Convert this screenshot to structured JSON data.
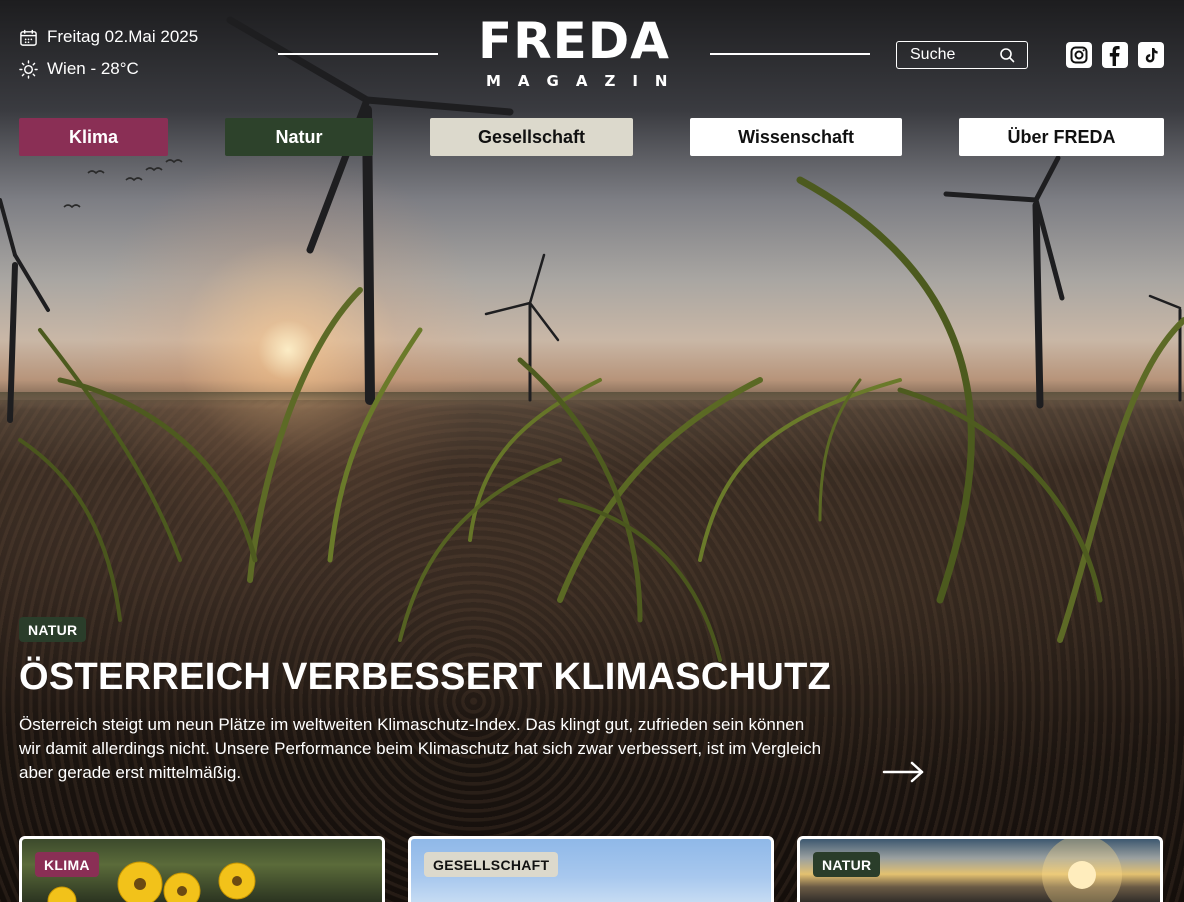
{
  "header": {
    "date": "Freitag 02.Mai 2025",
    "weather": "Wien - 28°C",
    "logo_main": "FREDA",
    "logo_sub": "MAGAZIN",
    "search_placeholder": "Suche"
  },
  "social": [
    "instagram-icon",
    "facebook-icon",
    "tiktok-icon"
  ],
  "nav": [
    {
      "label": "Klima",
      "color": "#8a2f55"
    },
    {
      "label": "Natur",
      "color": "#2d422b"
    },
    {
      "label": "Gesellschaft",
      "color": "#dcd9cc"
    },
    {
      "label": "Wissenschaft",
      "color": "#ffffff"
    },
    {
      "label": "Über FREDA",
      "color": "#ffffff"
    }
  ],
  "hero": {
    "tag": "NATUR",
    "title": "ÖSTERREICH VERBESSERT KLIMASCHUTZ",
    "text": "Österreich steigt um neun Plätze im weltweiten Klimaschutz-Index. Das klingt gut, zufrieden sein können wir damit allerdings nicht. Unsere Performance beim Klimaschutz hat sich zwar verbessert, ist im Vergleich aber gerade erst mittelmäßig.",
    "arrow_icon": "arrow-right-icon"
  },
  "cards": [
    {
      "tag": "KLIMA"
    },
    {
      "tag": "GESELLSCHAFT"
    },
    {
      "tag": "NATUR"
    }
  ]
}
